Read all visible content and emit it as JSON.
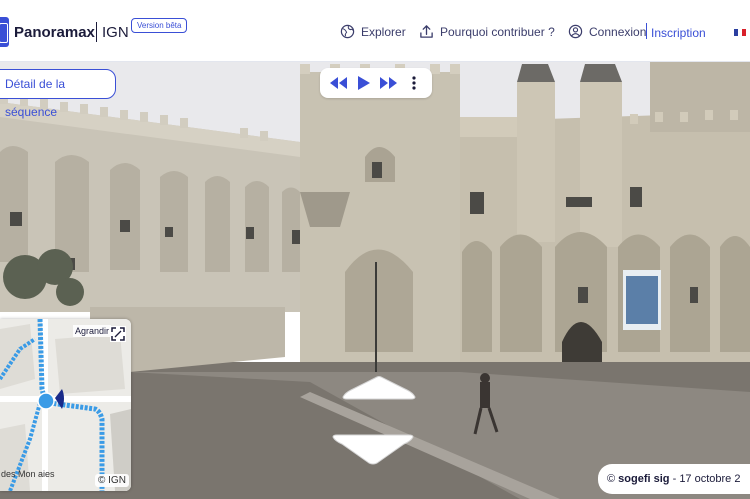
{
  "header": {
    "brand": "Panoramax",
    "brand_partner": "IGN",
    "beta_badge": "Version bêta",
    "nav": {
      "explore": "Explorer",
      "contribute": "Pourquoi contribuer ?",
      "login": "Connexion",
      "signup": "Inscription"
    },
    "language_flag": "fr-flag-icon"
  },
  "viewer": {
    "sequence_button": "Détail de la séquence",
    "player_controls": [
      "rewind-icon",
      "play-icon",
      "fast-forward-icon",
      "more-vertical-icon"
    ],
    "minimap": {
      "expand_label": "Agrandir",
      "street_label": "des Mon aies",
      "attribution": "© IGN"
    },
    "credit": {
      "author": "sogefi sig",
      "date": "17 octobre 2"
    },
    "nav_arrows": [
      "arrow-forward-icon",
      "arrow-backward-icon"
    ]
  },
  "colors": {
    "brand_blue": "#3a4fd6",
    "text_dark": "#1b1b3a",
    "sequence_blue": "#3a9be6",
    "marker_navy": "#1a2b8a"
  }
}
